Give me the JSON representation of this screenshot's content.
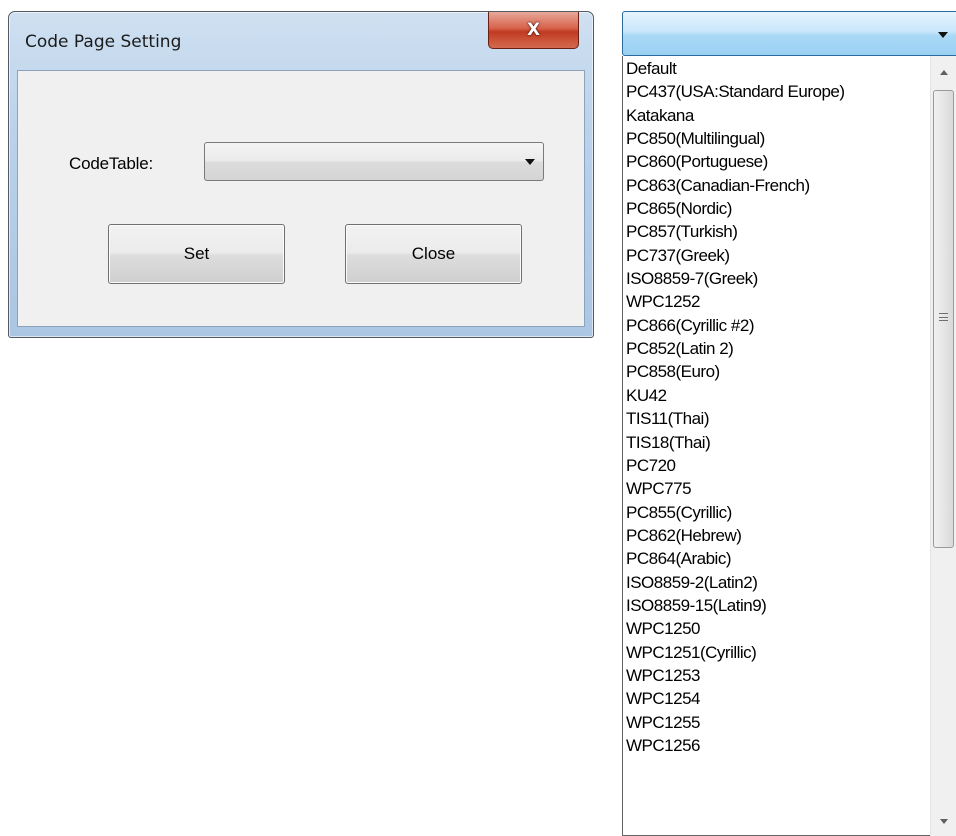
{
  "dialog": {
    "title": "Code Page Setting",
    "close_glyph": "X",
    "code_table_label": "CodeTable:",
    "code_table_value": "",
    "set_label": "Set",
    "close_label": "Close"
  },
  "dropdown": {
    "selected_value": "",
    "items": [
      "Default",
      "PC437(USA:Standard Europe)",
      "Katakana",
      "PC850(Multilingual)",
      "PC860(Portuguese)",
      "PC863(Canadian-French)",
      "PC865(Nordic)",
      "PC857(Turkish)",
      "PC737(Greek)",
      "ISO8859-7(Greek)",
      "WPC1252",
      "PC866(Cyrillic #2)",
      "PC852(Latin 2)",
      "PC858(Euro)",
      "KU42",
      "TIS11(Thai)",
      "TIS18(Thai)",
      "PC720",
      "WPC775",
      "PC855(Cyrillic)",
      "PC862(Hebrew)",
      "PC864(Arabic)",
      "ISO8859-2(Latin2)",
      "ISO8859-15(Latin9)",
      "WPC1250",
      "WPC1251(Cyrillic)",
      "WPC1253",
      "WPC1254",
      "WPC1255",
      "WPC1256"
    ]
  },
  "colors": {
    "title_bar": "#b9d1ea",
    "close_button": "#c13a22",
    "dropdown_highlight": "#a9d9f6",
    "client_background": "#f0f0f0"
  }
}
